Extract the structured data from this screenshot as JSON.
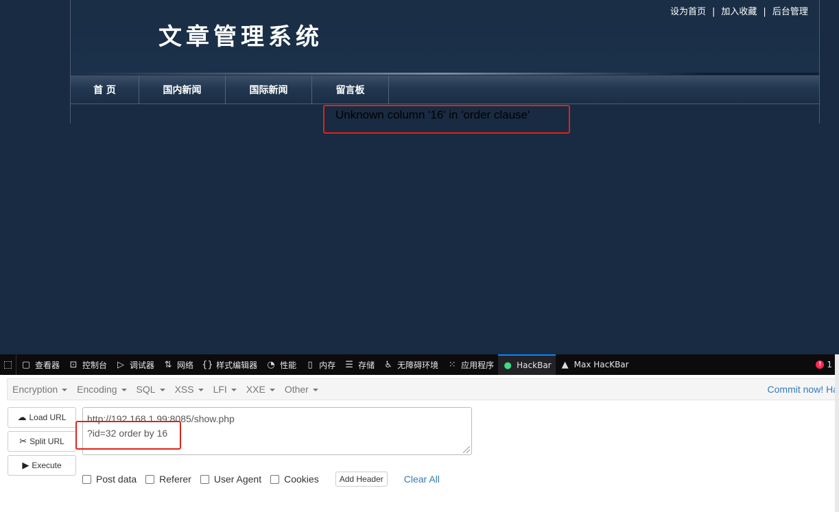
{
  "site": {
    "title": "文章管理系统",
    "top_links": [
      "设为首页",
      "加入收藏",
      "后台管理"
    ],
    "top_sep": "|",
    "nav": [
      "首 页",
      "国内新闻",
      "国际新闻",
      "留言板"
    ],
    "error_message": "Unknown column '16' in 'order clause'"
  },
  "devtools": {
    "tabs": [
      {
        "label": "查看器",
        "icon": "inspector-icon"
      },
      {
        "label": "控制台",
        "icon": "console-icon"
      },
      {
        "label": "调试器",
        "icon": "debugger-icon"
      },
      {
        "label": "网络",
        "icon": "network-icon"
      },
      {
        "label": "样式编辑器",
        "icon": "style-editor-icon"
      },
      {
        "label": "性能",
        "icon": "performance-icon"
      },
      {
        "label": "内存",
        "icon": "memory-icon"
      },
      {
        "label": "存储",
        "icon": "storage-icon"
      },
      {
        "label": "无障碍环境",
        "icon": "accessibility-icon"
      },
      {
        "label": "应用程序",
        "icon": "application-icon"
      },
      {
        "label": "HackBar",
        "icon": "hackbar-icon"
      },
      {
        "label": "Max HacKBar",
        "icon": "max-hackbar-icon"
      }
    ],
    "active_tab": "HackBar",
    "error_count": "1"
  },
  "hackbar": {
    "menu": [
      "Encryption",
      "Encoding",
      "SQL",
      "XSS",
      "LFI",
      "XXE",
      "Other"
    ],
    "commit": "Commit now! Ha",
    "buttons": {
      "load": "Load URL",
      "split": "Split URL",
      "execute": "Execute"
    },
    "url_line1": "http://192.168.1.99:8085/show.php",
    "url_line2": "?id=32 order by 16",
    "options": [
      "Post data",
      "Referer",
      "User Agent",
      "Cookies"
    ],
    "add_header": "Add Header",
    "clear_all": "Clear All"
  },
  "colors": {
    "page_bg": "#182b42",
    "highlight": "#e0221b",
    "link_blue": "#337ab7",
    "devtools_bg": "#0c0c0d"
  }
}
